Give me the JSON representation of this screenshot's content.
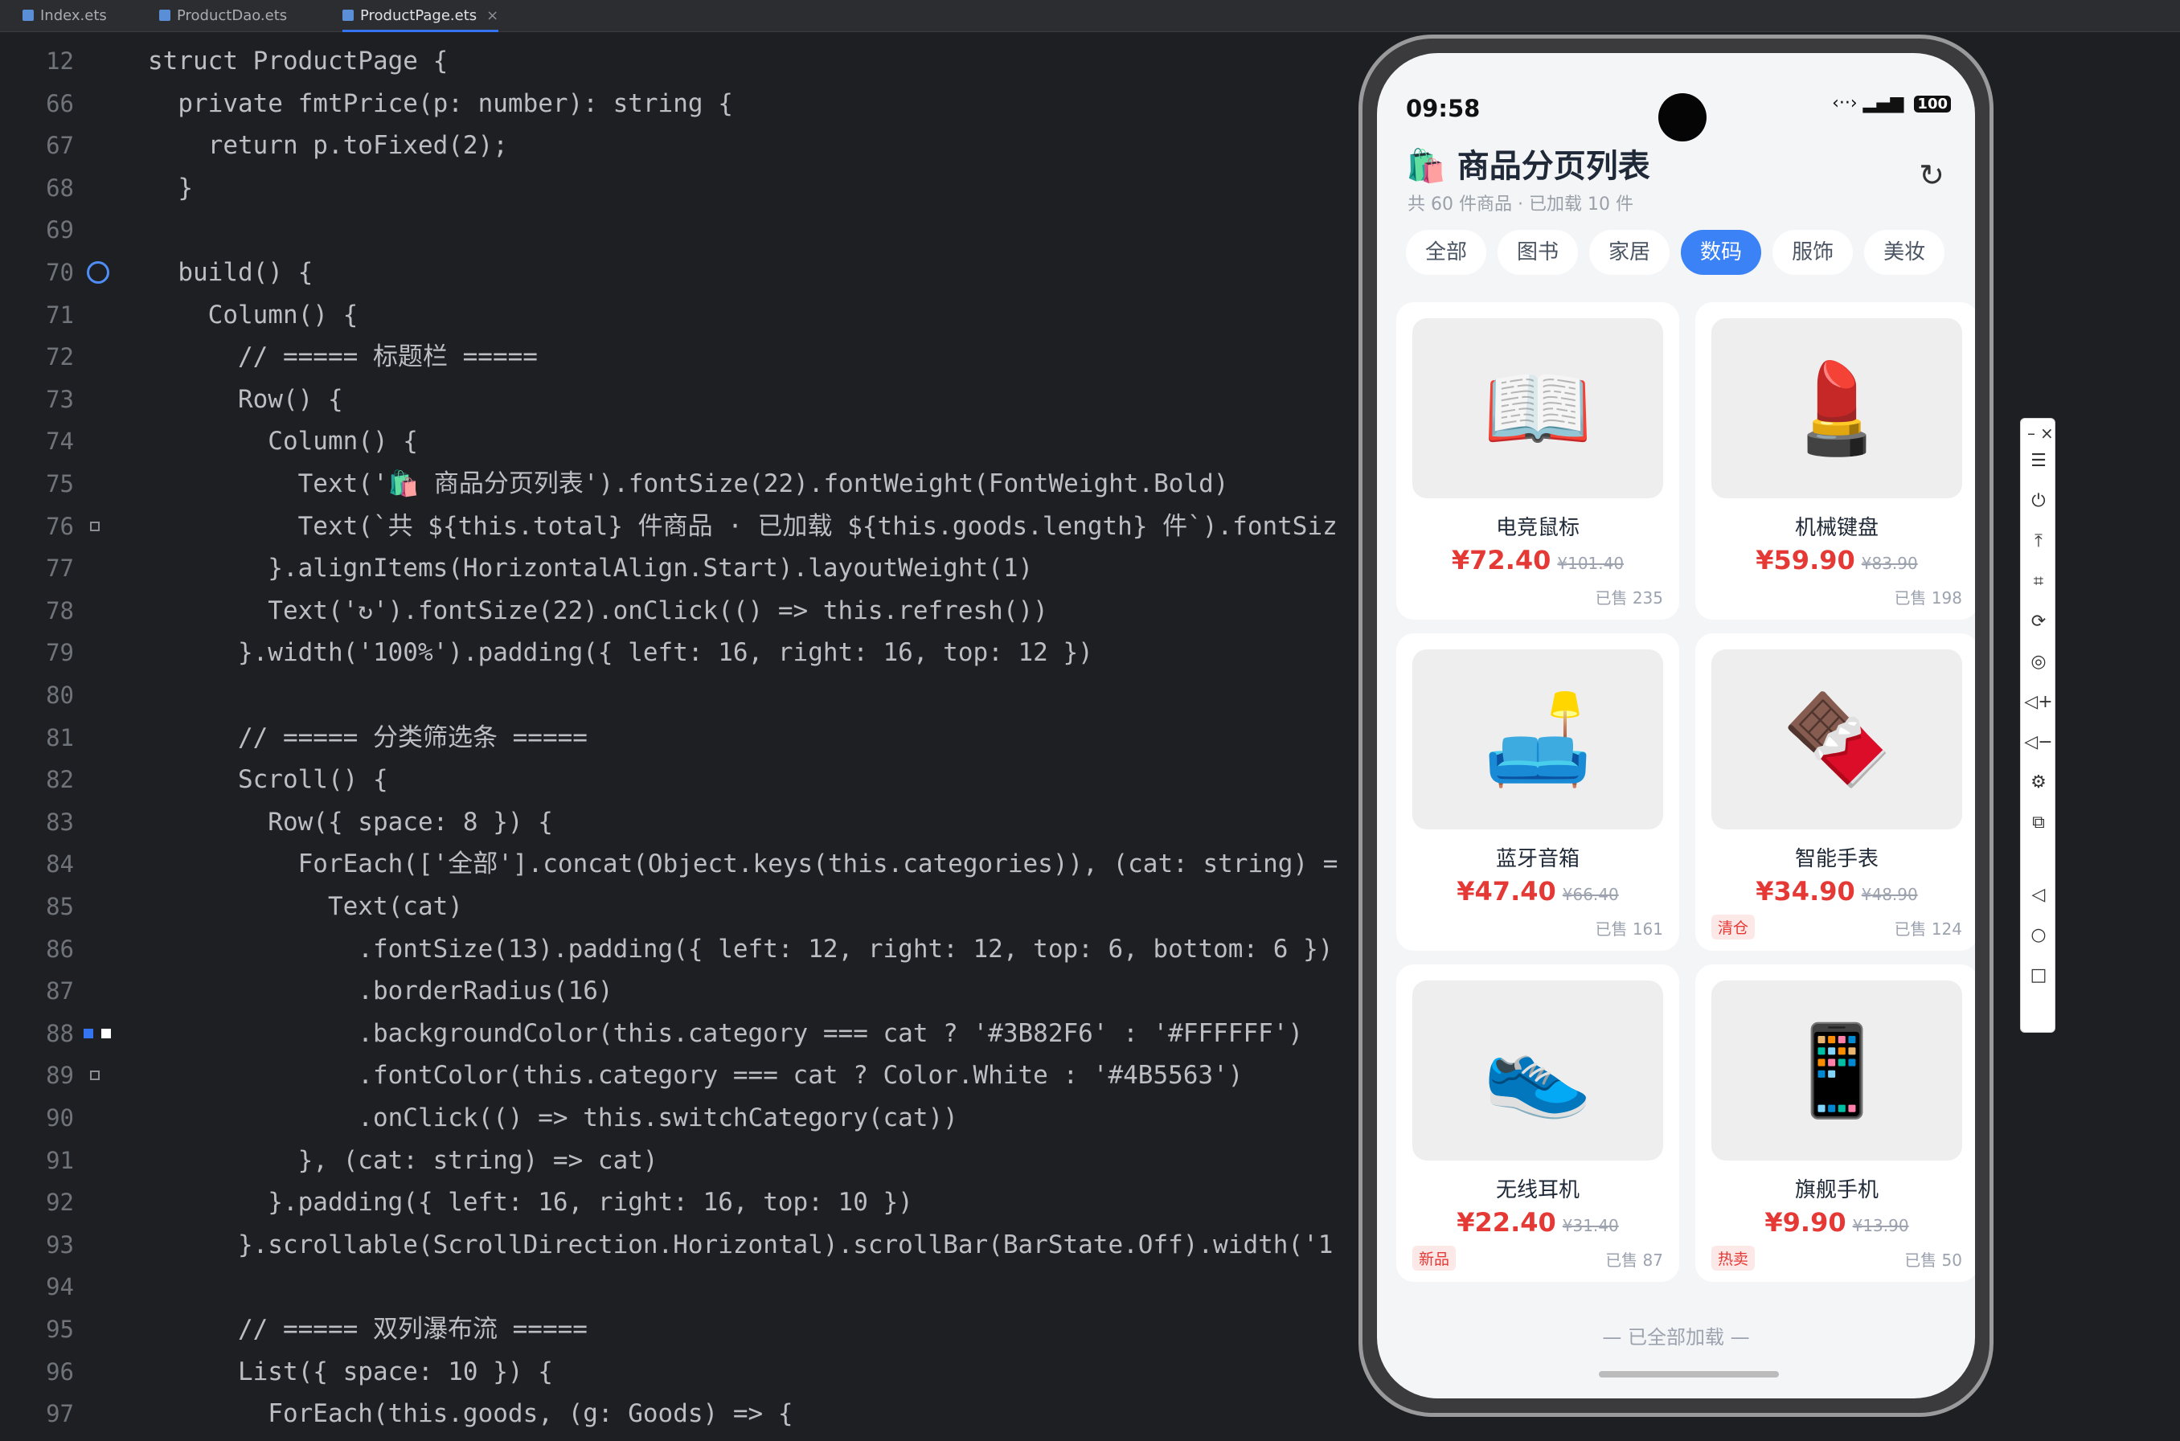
{
  "tabs": [
    "Index.ets",
    "ProductDao.ets",
    "ProductPage.ets"
  ],
  "editor": {
    "lines": [
      {
        "n": "12",
        "t": "struct ProductPage {"
      },
      {
        "n": "66",
        "t": "  private fmtPrice(p: number): string {"
      },
      {
        "n": "67",
        "t": "    return p.toFixed(2);"
      },
      {
        "n": "68",
        "t": "  }"
      },
      {
        "n": "69",
        "t": ""
      },
      {
        "n": "70",
        "t": "  build() {"
      },
      {
        "n": "71",
        "t": "    Column() {"
      },
      {
        "n": "72",
        "t": "      // ===== 标题栏 ====="
      },
      {
        "n": "73",
        "t": "      Row() {"
      },
      {
        "n": "74",
        "t": "        Column() {"
      },
      {
        "n": "75",
        "t": "          Text('🛍️ 商品分页列表').fontSize(22).fontWeight(FontWeight.Bold)"
      },
      {
        "n": "76",
        "t": "          Text(`共 ${this.total} 件商品 · 已加载 ${this.goods.length} 件`).fontSiz"
      },
      {
        "n": "77",
        "t": "        }.alignItems(HorizontalAlign.Start).layoutWeight(1)"
      },
      {
        "n": "78",
        "t": "        Text('↻').fontSize(22).onClick(() => this.refresh())"
      },
      {
        "n": "79",
        "t": "      }.width('100%').padding({ left: 16, right: 16, top: 12 })"
      },
      {
        "n": "80",
        "t": ""
      },
      {
        "n": "81",
        "t": "      // ===== 分类筛选条 ====="
      },
      {
        "n": "82",
        "t": "      Scroll() {"
      },
      {
        "n": "83",
        "t": "        Row({ space: 8 }) {"
      },
      {
        "n": "84",
        "t": "          ForEach(['全部'].concat(Object.keys(this.categories)), (cat: string) ="
      },
      {
        "n": "85",
        "t": "            Text(cat)"
      },
      {
        "n": "86",
        "t": "              .fontSize(13).padding({ left: 12, right: 12, top: 6, bottom: 6 })"
      },
      {
        "n": "87",
        "t": "              .borderRadius(16)"
      },
      {
        "n": "88",
        "t": "              .backgroundColor(this.category === cat ? '#3B82F6' : '#FFFFFF')"
      },
      {
        "n": "89",
        "t": "              .fontColor(this.category === cat ? Color.White : '#4B5563')"
      },
      {
        "n": "90",
        "t": "              .onClick(() => this.switchCategory(cat))"
      },
      {
        "n": "91",
        "t": "          }, (cat: string) => cat)"
      },
      {
        "n": "92",
        "t": "        }.padding({ left: 16, right: 16, top: 10 })"
      },
      {
        "n": "93",
        "t": "      }.scrollable(ScrollDirection.Horizontal).scrollBar(BarState.Off).width('1"
      },
      {
        "n": "94",
        "t": ""
      },
      {
        "n": "95",
        "t": "      // ===== 双列瀑布流 ====="
      },
      {
        "n": "96",
        "t": "      List({ space: 10 }) {"
      },
      {
        "n": "97",
        "t": "        ForEach(this.goods, (g: Goods) => {"
      }
    ]
  },
  "phone": {
    "time": "09:58",
    "battery": "100",
    "title": "商品分页列表",
    "subtitle": "共 60 件商品 · 已加载 10 件",
    "refresh": "↻",
    "categories": [
      "全部",
      "图书",
      "家居",
      "数码",
      "服饰",
      "美妆"
    ],
    "active_category": "数码",
    "products": [
      {
        "name": "电竞鼠标",
        "price": "¥72.40",
        "old": "¥101.40",
        "sold": "已售 235",
        "tag": "",
        "icon": "📖"
      },
      {
        "name": "机械键盘",
        "price": "¥59.90",
        "old": "¥83.90",
        "sold": "已售 198",
        "tag": "",
        "icon": "💄"
      },
      {
        "name": "蓝牙音箱",
        "price": "¥47.40",
        "old": "¥66.40",
        "sold": "已售 161",
        "tag": "",
        "icon": "🛋️"
      },
      {
        "name": "智能手表",
        "price": "¥34.90",
        "old": "¥48.90",
        "sold": "已售 124",
        "tag": "清仓",
        "icon": "🍫"
      },
      {
        "name": "无线耳机",
        "price": "¥22.40",
        "old": "¥31.40",
        "sold": "已售 87",
        "tag": "新品",
        "icon": "👟"
      },
      {
        "name": "旗舰手机",
        "price": "¥9.90",
        "old": "¥13.90",
        "sold": "已售 50",
        "tag": "热卖",
        "icon": "📱"
      }
    ],
    "footer": "— 已全部加载 —"
  }
}
